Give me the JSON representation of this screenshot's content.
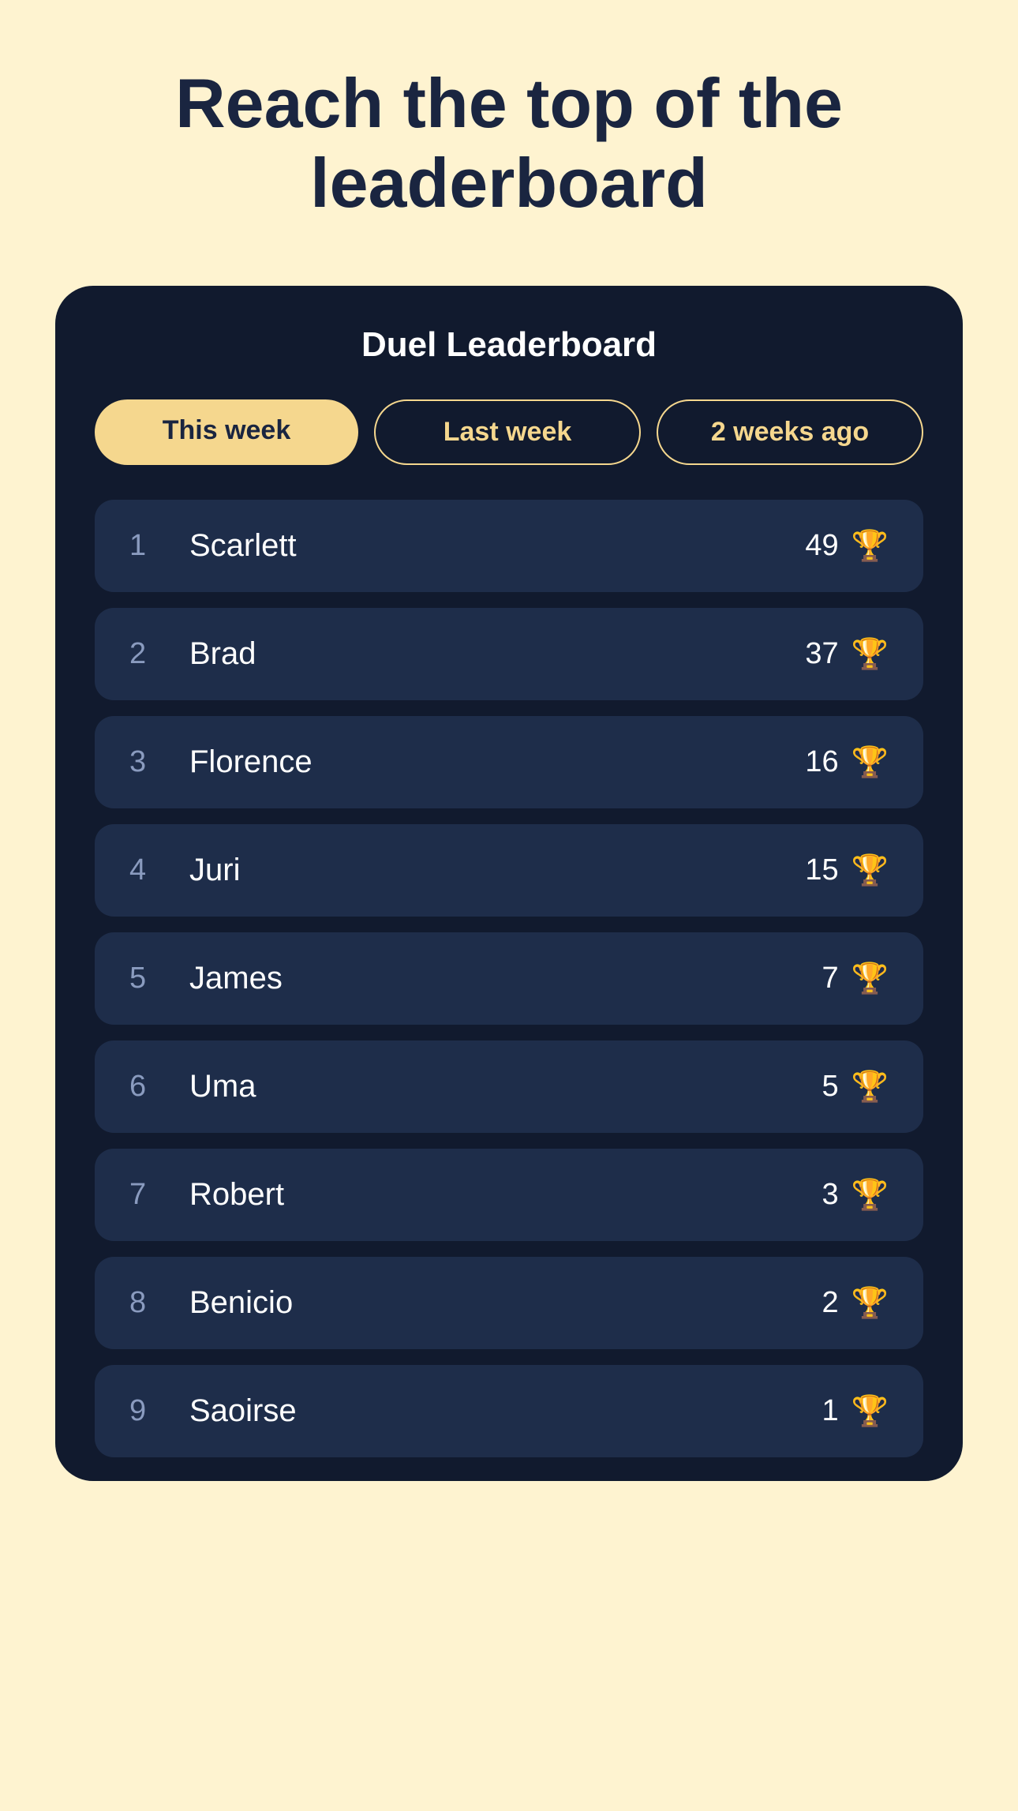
{
  "page": {
    "background_color": "#fef3d0",
    "title": "Reach the top of the leaderboard"
  },
  "leaderboard": {
    "card_title": "Duel Leaderboard",
    "tabs": [
      {
        "id": "this-week",
        "label": "This week",
        "active": true
      },
      {
        "id": "last-week",
        "label": "Last week",
        "active": false
      },
      {
        "id": "two-weeks-ago",
        "label": "2 weeks ago",
        "active": false
      }
    ],
    "entries": [
      {
        "rank": "1",
        "name": "Scarlett",
        "score": "49"
      },
      {
        "rank": "2",
        "name": "Brad",
        "score": "37"
      },
      {
        "rank": "3",
        "name": "Florence",
        "score": "16"
      },
      {
        "rank": "4",
        "name": "Juri",
        "score": "15"
      },
      {
        "rank": "5",
        "name": "James",
        "score": "7"
      },
      {
        "rank": "6",
        "name": "Uma",
        "score": "5"
      },
      {
        "rank": "7",
        "name": "Robert",
        "score": "3"
      },
      {
        "rank": "8",
        "name": "Benicio",
        "score": "2"
      },
      {
        "rank": "9",
        "name": "Saoirse",
        "score": "1"
      }
    ],
    "trophy_symbol": "🏆"
  }
}
